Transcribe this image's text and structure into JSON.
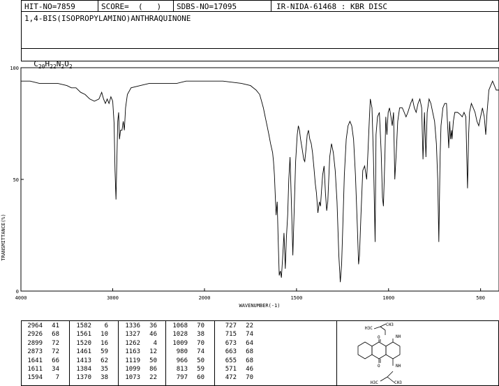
{
  "header": {
    "hit_no": "HIT-NO=7859",
    "score": "SCORE=  (   )",
    "sdbs_no": "SDBS-NO=17095",
    "method": "IR-NIDA-61468 : KBR DISC",
    "compound": "1,4-BIS(ISOPROPYLAMINO)ANTHRAQUINONE",
    "formula_parts": [
      "C",
      "20",
      "H",
      "22",
      "N",
      "2",
      "O",
      "2"
    ]
  },
  "chart_data": {
    "type": "line",
    "xlabel": "WAVENUMBER(-1)",
    "ylabel": "TRANSMITTANCE(%)",
    "xlim": [
      4000,
      400
    ],
    "ylim": [
      0,
      100
    ],
    "xticks": [
      "4000",
      "3000",
      "2000",
      "1500",
      "1000",
      "500"
    ],
    "xtick_values": [
      4000,
      3000,
      2000,
      1500,
      1000,
      500
    ],
    "yticks": [
      "0",
      "50",
      "100"
    ],
    "ytick_values": [
      0,
      50,
      100
    ],
    "series": [
      {
        "points": [
          [
            4000,
            94
          ],
          [
            3900,
            94
          ],
          [
            3800,
            93
          ],
          [
            3700,
            93
          ],
          [
            3600,
            93
          ],
          [
            3500,
            92
          ],
          [
            3450,
            91
          ],
          [
            3400,
            91
          ],
          [
            3350,
            89
          ],
          [
            3300,
            88
          ],
          [
            3250,
            86
          ],
          [
            3200,
            85
          ],
          [
            3150,
            86
          ],
          [
            3120,
            89
          ],
          [
            3100,
            86
          ],
          [
            3080,
            84
          ],
          [
            3060,
            86
          ],
          [
            3040,
            84
          ],
          [
            3020,
            87
          ],
          [
            3000,
            85
          ],
          [
            2985,
            75
          ],
          [
            2975,
            54
          ],
          [
            2964,
            41
          ],
          [
            2955,
            58
          ],
          [
            2945,
            76
          ],
          [
            2935,
            80
          ],
          [
            2926,
            68
          ],
          [
            2915,
            72
          ],
          [
            2899,
            72
          ],
          [
            2885,
            76
          ],
          [
            2873,
            72
          ],
          [
            2860,
            82
          ],
          [
            2840,
            88
          ],
          [
            2800,
            91
          ],
          [
            2700,
            92
          ],
          [
            2600,
            93
          ],
          [
            2500,
            93
          ],
          [
            2400,
            93
          ],
          [
            2300,
            93
          ],
          [
            2200,
            94
          ],
          [
            2100,
            94
          ],
          [
            2000,
            94
          ],
          [
            1900,
            94
          ],
          [
            1800,
            93
          ],
          [
            1750,
            92
          ],
          [
            1720,
            90
          ],
          [
            1700,
            88
          ],
          [
            1690,
            85
          ],
          [
            1680,
            82
          ],
          [
            1670,
            78
          ],
          [
            1660,
            74
          ],
          [
            1650,
            70
          ],
          [
            1641,
            66
          ],
          [
            1630,
            62
          ],
          [
            1625,
            58
          ],
          [
            1620,
            52
          ],
          [
            1611,
            34
          ],
          [
            1605,
            40
          ],
          [
            1600,
            24
          ],
          [
            1594,
            7
          ],
          [
            1588,
            9
          ],
          [
            1582,
            6
          ],
          [
            1576,
            14
          ],
          [
            1572,
            20
          ],
          [
            1568,
            26
          ],
          [
            1561,
            10
          ],
          [
            1555,
            24
          ],
          [
            1548,
            34
          ],
          [
            1542,
            50
          ],
          [
            1535,
            60
          ],
          [
            1528,
            40
          ],
          [
            1520,
            16
          ],
          [
            1512,
            38
          ],
          [
            1505,
            58
          ],
          [
            1496,
            70
          ],
          [
            1490,
            74
          ],
          [
            1484,
            72
          ],
          [
            1478,
            68
          ],
          [
            1470,
            64
          ],
          [
            1461,
            59
          ],
          [
            1455,
            58
          ],
          [
            1448,
            64
          ],
          [
            1442,
            70
          ],
          [
            1435,
            72
          ],
          [
            1428,
            68
          ],
          [
            1420,
            66
          ],
          [
            1413,
            62
          ],
          [
            1405,
            55
          ],
          [
            1398,
            48
          ],
          [
            1392,
            44
          ],
          [
            1384,
            35
          ],
          [
            1376,
            40
          ],
          [
            1370,
            38
          ],
          [
            1364,
            45
          ],
          [
            1358,
            52
          ],
          [
            1350,
            56
          ],
          [
            1343,
            44
          ],
          [
            1336,
            36
          ],
          [
            1330,
            40
          ],
          [
            1327,
            46
          ],
          [
            1320,
            60
          ],
          [
            1310,
            66
          ],
          [
            1300,
            62
          ],
          [
            1290,
            54
          ],
          [
            1280,
            40
          ],
          [
            1270,
            16
          ],
          [
            1262,
            4
          ],
          [
            1255,
            12
          ],
          [
            1248,
            30
          ],
          [
            1240,
            52
          ],
          [
            1230,
            68
          ],
          [
            1220,
            74
          ],
          [
            1210,
            76
          ],
          [
            1200,
            74
          ],
          [
            1190,
            68
          ],
          [
            1180,
            52
          ],
          [
            1170,
            30
          ],
          [
            1163,
            12
          ],
          [
            1158,
            16
          ],
          [
            1150,
            34
          ],
          [
            1140,
            54
          ],
          [
            1130,
            56
          ],
          [
            1119,
            50
          ],
          [
            1112,
            62
          ],
          [
            1105,
            76
          ],
          [
            1099,
            86
          ],
          [
            1090,
            82
          ],
          [
            1082,
            60
          ],
          [
            1073,
            22
          ],
          [
            1068,
            70
          ],
          [
            1060,
            78
          ],
          [
            1050,
            80
          ],
          [
            1040,
            62
          ],
          [
            1033,
            42
          ],
          [
            1028,
            38
          ],
          [
            1020,
            60
          ],
          [
            1015,
            78
          ],
          [
            1009,
            70
          ],
          [
            1002,
            80
          ],
          [
            995,
            82
          ],
          [
            987,
            78
          ],
          [
            980,
            74
          ],
          [
            973,
            80
          ],
          [
            966,
            50
          ],
          [
            958,
            62
          ],
          [
            950,
            76
          ],
          [
            940,
            82
          ],
          [
            925,
            82
          ],
          [
            915,
            80
          ],
          [
            905,
            78
          ],
          [
            895,
            80
          ],
          [
            880,
            84
          ],
          [
            870,
            86
          ],
          [
            860,
            82
          ],
          [
            850,
            80
          ],
          [
            840,
            84
          ],
          [
            830,
            86
          ],
          [
            820,
            82
          ],
          [
            813,
            59
          ],
          [
            805,
            80
          ],
          [
            797,
            60
          ],
          [
            790,
            80
          ],
          [
            780,
            86
          ],
          [
            770,
            84
          ],
          [
            760,
            80
          ],
          [
            750,
            76
          ],
          [
            740,
            66
          ],
          [
            733,
            50
          ],
          [
            727,
            22
          ],
          [
            720,
            60
          ],
          [
            715,
            74
          ],
          [
            705,
            82
          ],
          [
            695,
            84
          ],
          [
            685,
            84
          ],
          [
            673,
            64
          ],
          [
            668,
            76
          ],
          [
            663,
            68
          ],
          [
            658,
            72
          ],
          [
            655,
            68
          ],
          [
            648,
            76
          ],
          [
            640,
            80
          ],
          [
            625,
            80
          ],
          [
            610,
            79
          ],
          [
            600,
            78
          ],
          [
            590,
            80
          ],
          [
            580,
            78
          ],
          [
            571,
            46
          ],
          [
            565,
            70
          ],
          [
            560,
            80
          ],
          [
            550,
            84
          ],
          [
            540,
            82
          ],
          [
            530,
            80
          ],
          [
            520,
            76
          ],
          [
            510,
            74
          ],
          [
            500,
            78
          ],
          [
            490,
            82
          ],
          [
            480,
            78
          ],
          [
            472,
            70
          ],
          [
            465,
            80
          ],
          [
            455,
            90
          ],
          [
            445,
            92
          ],
          [
            435,
            94
          ],
          [
            425,
            92
          ],
          [
            415,
            90
          ],
          [
            400,
            90
          ]
        ]
      }
    ]
  },
  "peak_table": [
    [
      [
        "2964",
        "41"
      ],
      [
        "2926",
        "68"
      ],
      [
        "2899",
        "72"
      ],
      [
        "2873",
        "72"
      ],
      [
        "1641",
        "66"
      ],
      [
        "1611",
        "34"
      ],
      [
        "1594",
        "7"
      ]
    ],
    [
      [
        "1582",
        "6"
      ],
      [
        "1561",
        "10"
      ],
      [
        "1520",
        "16"
      ],
      [
        "1461",
        "59"
      ],
      [
        "1413",
        "62"
      ],
      [
        "1384",
        "35"
      ],
      [
        "1370",
        "38"
      ]
    ],
    [
      [
        "1336",
        "36"
      ],
      [
        "1327",
        "46"
      ],
      [
        "1262",
        "4"
      ],
      [
        "1163",
        "12"
      ],
      [
        "1119",
        "50"
      ],
      [
        "1099",
        "86"
      ],
      [
        "1073",
        "22"
      ]
    ],
    [
      [
        "1068",
        "70"
      ],
      [
        "1028",
        "38"
      ],
      [
        "1009",
        "70"
      ],
      [
        "980",
        "74"
      ],
      [
        "966",
        "50"
      ],
      [
        "813",
        "59"
      ],
      [
        "797",
        "60"
      ]
    ],
    [
      [
        "727",
        "22"
      ],
      [
        "715",
        "74"
      ],
      [
        "673",
        "64"
      ],
      [
        "663",
        "68"
      ],
      [
        "655",
        "68"
      ],
      [
        "571",
        "46"
      ],
      [
        "472",
        "70"
      ]
    ]
  ],
  "structure": {
    "label_nh": "NH",
    "label_o": "O",
    "label_h3c": "H3C",
    "label_ch3": "CH3"
  }
}
